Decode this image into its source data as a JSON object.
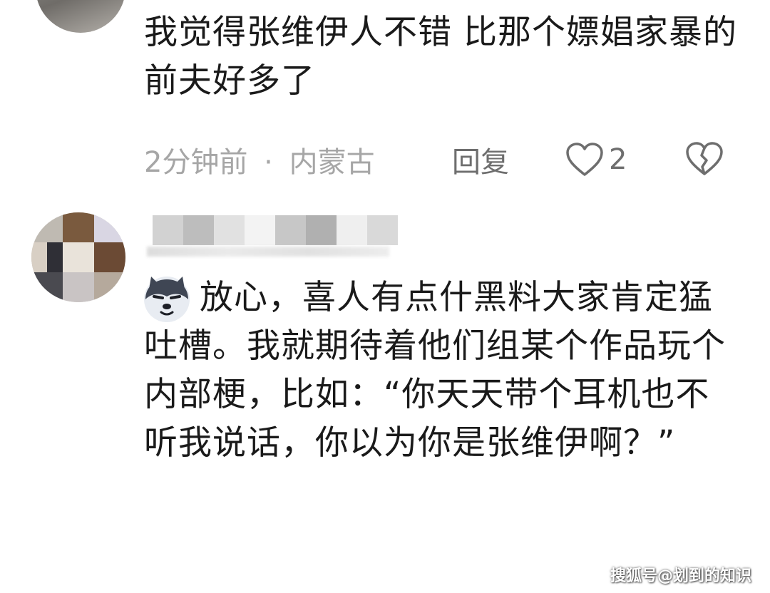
{
  "comments": [
    {
      "text": "我觉得张维伊人不错 比那个嫖娼家暴的前夫好多了",
      "time": "2分钟前",
      "separator": "·",
      "location": "内蒙古",
      "reply_label": "回复",
      "like_count": "2"
    },
    {
      "text": "放心，喜人有点什黑料大家肯定猛吐槽。我就期待着他们组某个作品玩个内部梗，比如：“你天天带个耳机也不听我说话，你以为你是张维伊啊？”"
    }
  ],
  "icons": {
    "like": "heart-outline-icon",
    "dislike": "broken-heart-icon",
    "sticker": "husky-emoji-icon"
  },
  "watermark": "搜狐号@划到的知识",
  "colors": {
    "text": "#1a1a1a",
    "meta": "#a6a6a6",
    "action": "#6e6e6e"
  }
}
